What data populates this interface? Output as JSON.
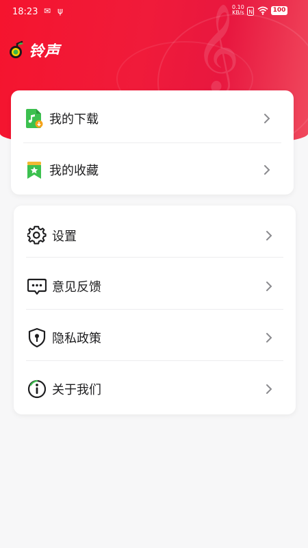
{
  "status_bar": {
    "time": "18:23",
    "speed_value": "0.10",
    "speed_unit": "KB/s",
    "battery": "100",
    "icons": [
      "mail-icon",
      "usb-icon",
      "nfc-icon",
      "wifi-icon",
      "battery-icon"
    ]
  },
  "brand": {
    "name": "铃声",
    "accent_color": "#f0142e"
  },
  "menu_group_1": [
    {
      "label": "我的下载",
      "icon": "music-download-icon"
    },
    {
      "label": "我的收藏",
      "icon": "star-bookmark-icon"
    }
  ],
  "menu_group_2": [
    {
      "label": "设置",
      "icon": "settings-gear-icon"
    },
    {
      "label": "意见反馈",
      "icon": "feedback-chat-icon"
    },
    {
      "label": "隐私政策",
      "icon": "privacy-shield-icon"
    },
    {
      "label": "关于我们",
      "icon": "info-icon"
    }
  ]
}
